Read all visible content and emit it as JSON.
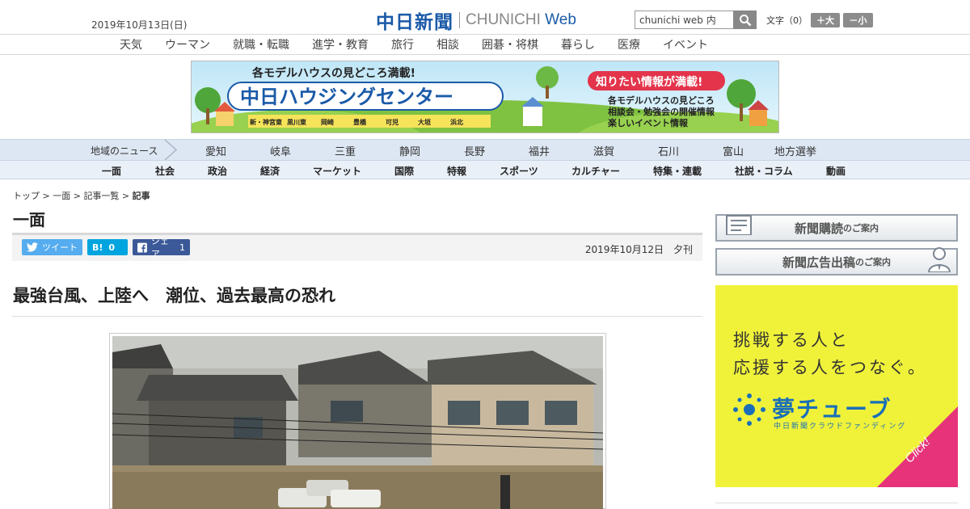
{
  "header": {
    "date": "2019年10月13日(日)",
    "logo_ja": "中日新聞",
    "logo_en_main": "CHUNICHI",
    "logo_en_sub": "Web",
    "search_value": "chunichi web 内",
    "font_size_label": "文字（0）",
    "font_plus": "＋大",
    "font_minus": "－小"
  },
  "topnav": [
    "天気",
    "ウーマン",
    "就職・転職",
    "進学・教育",
    "旅行",
    "相談",
    "囲碁・将棋",
    "暮らし",
    "医療",
    "イベント"
  ],
  "banner": {
    "headline_top": "各モデルハウスの見どころ満載!",
    "title": "中日ハウジングセンター",
    "badge": "知りたい情報が満載!",
    "points": [
      "各モデルハウスの見どころ",
      "相談会・勉強会の開催情報",
      "楽しいイベント情報"
    ],
    "locations": [
      "新・神宮東",
      "黒川東",
      "岡崎",
      "豊橋",
      "可児",
      "大垣",
      "浜北"
    ]
  },
  "regionnav": {
    "label": "地域のニュース",
    "items": [
      "愛知",
      "岐阜",
      "三重",
      "静岡",
      "長野",
      "福井",
      "滋賀",
      "石川",
      "富山",
      "地方選挙"
    ]
  },
  "sectionnav": [
    "一面",
    "社会",
    "政治",
    "経済",
    "マーケット",
    "国際",
    "特報",
    "スポーツ",
    "カルチャー",
    "特集・連載",
    "社説・コラム",
    "動画"
  ],
  "article": {
    "breadcrumb": [
      "トップ",
      "一面",
      "記事一覧"
    ],
    "breadcrumb_current": "記事",
    "page_title": "一面",
    "tweet_label": "ツイート",
    "hatena_label": "B!",
    "hatena_count": "0",
    "fb_label": "シェア",
    "fb_count": "1",
    "date": "2019年10月12日　夕刊",
    "headline": "最強台風、上陸へ　潮位、過去最高の恐れ"
  },
  "sidebar": {
    "subscribe_main": "新聞購読",
    "subscribe_small": "のご案内",
    "ad_main": "新聞広告出稿",
    "ad_small": "のご案内",
    "ad_line1": "挑戦する人と",
    "ad_line2": "応援する人をつなぐ。",
    "ad_brand": "夢チューブ",
    "ad_sub": "中日新聞クラウドファンディング",
    "ad_click": "Click!"
  },
  "colors": {
    "brand_blue": "#1a5aa8",
    "twitter": "#55acee",
    "hatena": "#00a4de",
    "facebook": "#3b5998",
    "ad_yellow": "#f0f23a",
    "click_pink": "#e6337a"
  }
}
